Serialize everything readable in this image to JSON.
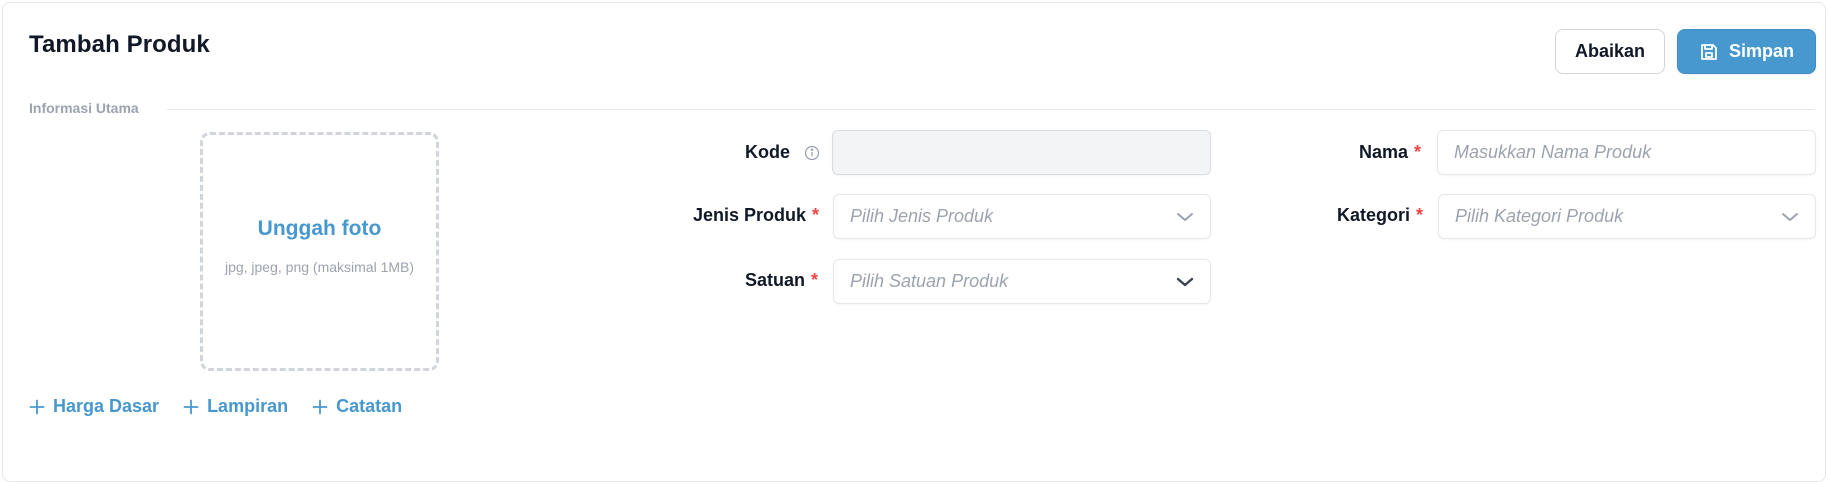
{
  "header": {
    "title": "Tambah Produk",
    "cancel_label": "Abaikan",
    "save_label": "Simpan"
  },
  "section": {
    "label": "Informasi Utama"
  },
  "upload": {
    "title": "Unggah foto",
    "hint": "jpg, jpeg, png (maksimal 1MB)"
  },
  "fields": {
    "kode": {
      "label": "Kode",
      "value": ""
    },
    "nama": {
      "label": "Nama",
      "required_mark": "*",
      "placeholder": "Masukkan Nama Produk"
    },
    "jenis_produk": {
      "label": "Jenis Produk",
      "required_mark": "*",
      "placeholder": "Pilih Jenis Produk"
    },
    "kategori": {
      "label": "Kategori",
      "required_mark": "*",
      "placeholder": "Pilih Kategori Produk"
    },
    "satuan": {
      "label": "Satuan",
      "required_mark": "*",
      "placeholder": "Pilih Satuan Produk"
    }
  },
  "add_links": [
    {
      "label": "Harga Dasar"
    },
    {
      "label": "Lampiran"
    },
    {
      "label": "Catatan"
    }
  ],
  "colors": {
    "accent": "#4798cf",
    "required": "#ef4444",
    "muted": "#9ca3af"
  },
  "icons": {
    "save": "floppy-disk-icon",
    "info": "info-circle-icon",
    "chevron": "chevron-down-icon",
    "plus": "plus-icon"
  }
}
